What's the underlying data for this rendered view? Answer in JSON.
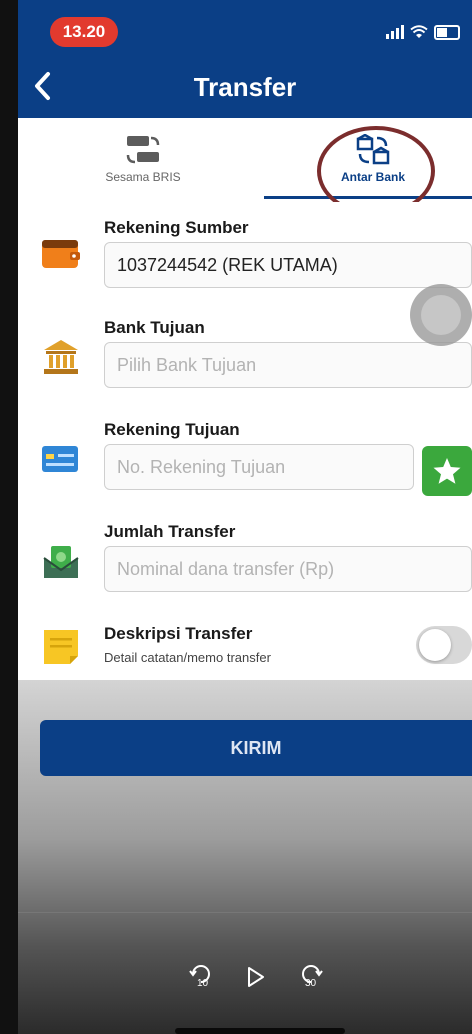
{
  "status": {
    "time": "13.20"
  },
  "nav": {
    "title": "Transfer"
  },
  "tabs": [
    {
      "label": "Sesama BRIS",
      "active": false
    },
    {
      "label": "Antar Bank",
      "active": true
    }
  ],
  "form": {
    "source_account": {
      "label": "Rekening Sumber",
      "value": "1037244542 (REK UTAMA)"
    },
    "bank": {
      "label": "Bank Tujuan",
      "placeholder": "Pilih Bank Tujuan"
    },
    "dest_account": {
      "label": "Rekening Tujuan",
      "placeholder": "No. Rekening Tujuan"
    },
    "amount": {
      "label": "Jumlah Transfer",
      "placeholder": "Nominal dana transfer (Rp)"
    },
    "description": {
      "label": "Deskripsi Transfer",
      "sublabel": "Detail catatan/memo transfer",
      "enabled": false
    }
  },
  "submit": {
    "label": "KIRIM"
  },
  "player": {
    "rewind_seconds": "10",
    "forward_seconds": "30"
  },
  "colors": {
    "primary": "#0b3f86",
    "time_pill": "#e23a2e",
    "favorite": "#3ba83d",
    "annotation": "#7b2d2d"
  }
}
